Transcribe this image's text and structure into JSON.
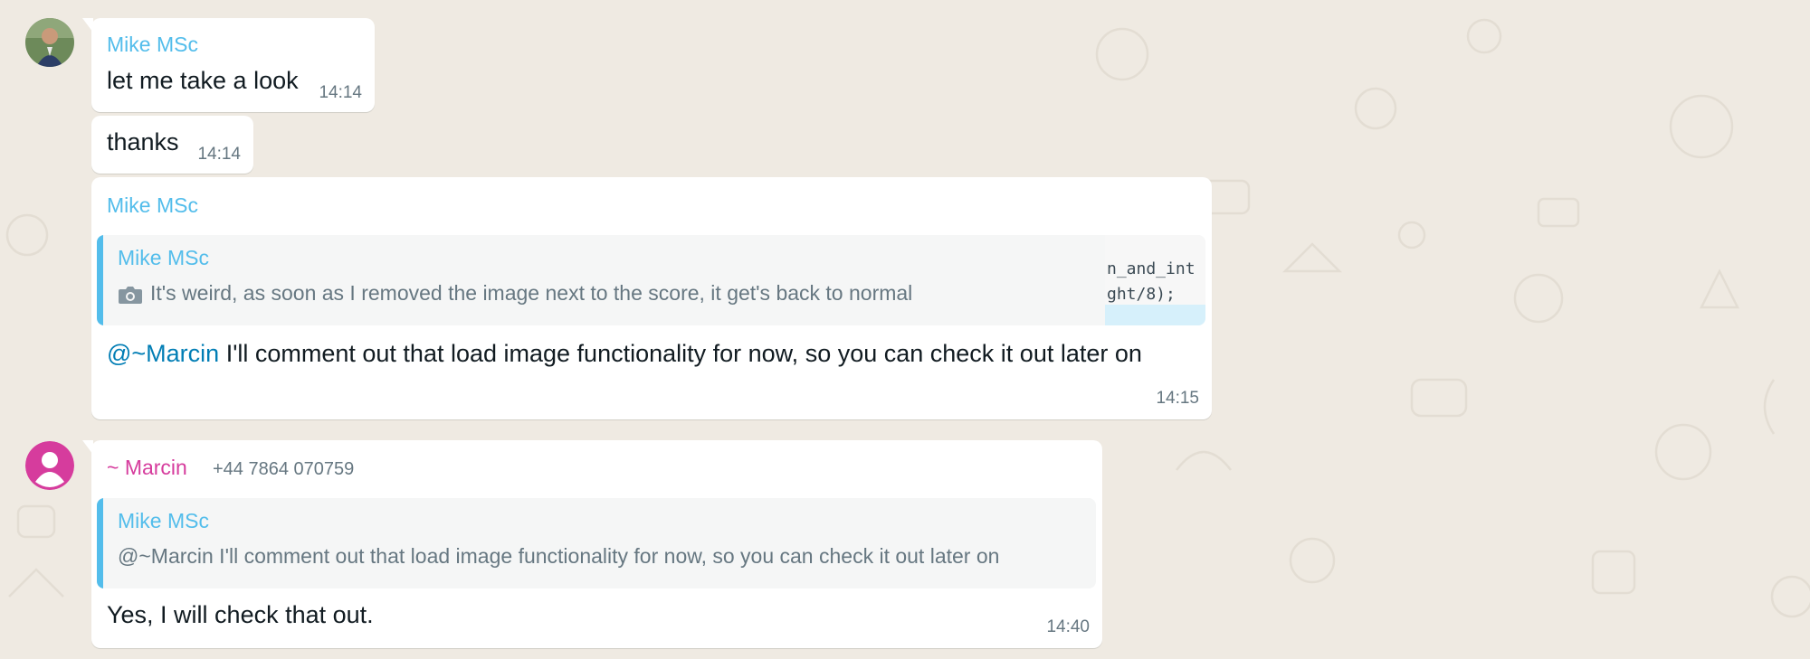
{
  "colors": {
    "background": "#efeae2",
    "bubble": "#ffffff",
    "sender_mike": "#53bdeb",
    "sender_marcin": "#d63c9d",
    "mention": "#027eb5",
    "time": "#667781",
    "quote_bg": "#f5f6f6"
  },
  "messages": [
    {
      "sender": "Mike MSc",
      "text": "let me take a look",
      "time": "14:14"
    },
    {
      "text": "thanks",
      "time": "14:14"
    },
    {
      "sender": "Mike MSc",
      "quote": {
        "name": "Mike MSc",
        "icon": "camera-icon",
        "text": "It's weird, as soon as I removed the image next to the score, it get's back to normal",
        "code_line_1": "n_and_int",
        "code_line_2": "ght/8);"
      },
      "mention": "@~Marcin",
      "text": " I'll comment out that load image functionality for now, so you can check it out later on",
      "time": "14:15"
    },
    {
      "sender": "~ Marcin",
      "phone": "+44 7864 070759",
      "quote": {
        "name": "Mike MSc",
        "text": "@~Marcin I'll comment out that load image functionality for now, so you can check it out later on"
      },
      "text": "Yes, I will check that out.",
      "time": "14:40"
    }
  ]
}
